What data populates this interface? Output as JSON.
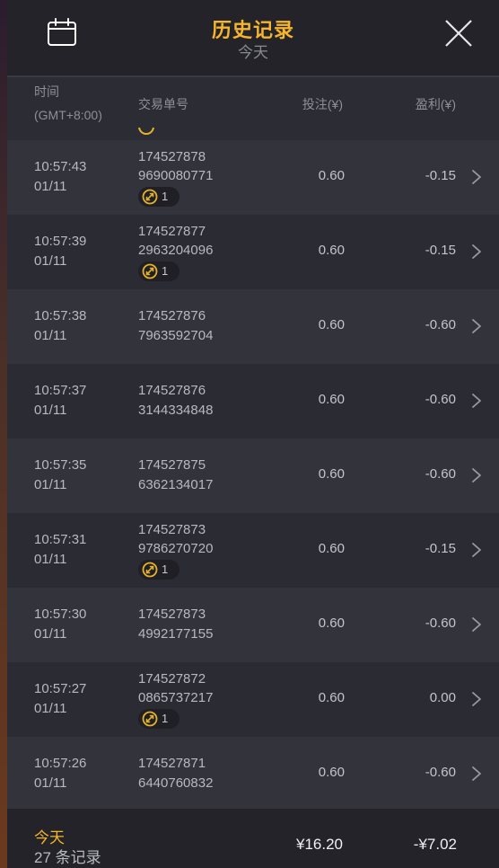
{
  "header": {
    "title": "历史记录",
    "subtitle": "今天",
    "calendar_icon": "calendar-icon",
    "close_icon": "close-icon"
  },
  "columns": {
    "time_line1": "时间",
    "time_line2": "(GMT+8:00)",
    "order_id": "交易单号",
    "bet": "投注(¥)",
    "profit": "盈利(¥)"
  },
  "rows": [
    {
      "time": "10:57:43",
      "date": "01/11",
      "id1": "174527878",
      "id2": "9690080771",
      "bet": "0.60",
      "profit": "-0.15",
      "badge": "1"
    },
    {
      "time": "10:57:39",
      "date": "01/11",
      "id1": "174527877",
      "id2": "2963204096",
      "bet": "0.60",
      "profit": "-0.15",
      "badge": "1"
    },
    {
      "time": "10:57:38",
      "date": "01/11",
      "id1": "174527876",
      "id2": "7963592704",
      "bet": "0.60",
      "profit": "-0.60",
      "badge": null
    },
    {
      "time": "10:57:37",
      "date": "01/11",
      "id1": "174527876",
      "id2": "3144334848",
      "bet": "0.60",
      "profit": "-0.60",
      "badge": null
    },
    {
      "time": "10:57:35",
      "date": "01/11",
      "id1": "174527875",
      "id2": "6362134017",
      "bet": "0.60",
      "profit": "-0.60",
      "badge": null
    },
    {
      "time": "10:57:31",
      "date": "01/11",
      "id1": "174527873",
      "id2": "9786270720",
      "bet": "0.60",
      "profit": "-0.15",
      "badge": "1"
    },
    {
      "time": "10:57:30",
      "date": "01/11",
      "id1": "174527873",
      "id2": "4992177155",
      "bet": "0.60",
      "profit": "-0.60",
      "badge": null
    },
    {
      "time": "10:57:27",
      "date": "01/11",
      "id1": "174527872",
      "id2": "0865737217",
      "bet": "0.60",
      "profit": "0.00",
      "badge": "1"
    },
    {
      "time": "10:57:26",
      "date": "01/11",
      "id1": "174527871",
      "id2": "6440760832",
      "bet": "0.60",
      "profit": "-0.60",
      "badge": null
    }
  ],
  "footer": {
    "today": "今天",
    "count": "27 条记录",
    "total_bet": "¥16.20",
    "total_profit": "-¥7.02"
  },
  "colors": {
    "accent": "#f5b52c",
    "badge_ring": "#e4b22a"
  }
}
